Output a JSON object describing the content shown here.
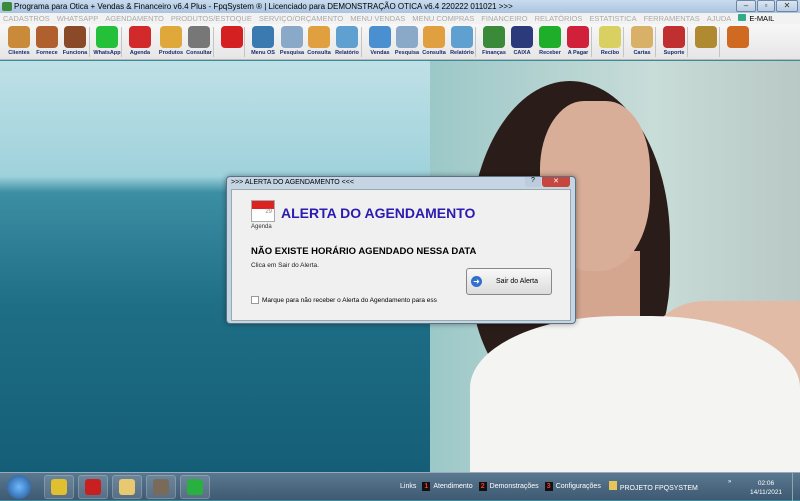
{
  "window": {
    "title": "Programa para Otica + Vendas & Financeiro v6.4 Plus - FpqSystem ® | Licenciado para  DEMONSTRAÇÃO OTICA v6.4 220222 011021 >>>",
    "minimize": "–",
    "maximize": "▫",
    "close": "✕"
  },
  "menu": [
    "CADASTROS",
    "WHATSAPP",
    "AGENDAMENTO",
    "PRODUTOS/ESTOQUE",
    "SERVIÇO/ORÇAMENTO",
    "MENU VENDAS",
    "MENU COMPRAS",
    "FINANCEIRO",
    "RELATÓRIOS",
    "ESTATISTICA",
    "FERRAMENTAS",
    "AJUDA"
  ],
  "menu_email": "E-MAIL",
  "toolbar": [
    {
      "label": "Clientes",
      "color": "#c98a3a"
    },
    {
      "label": "Fornece",
      "color": "#b0602f"
    },
    {
      "label": "Funciona",
      "color": "#8a4a2a"
    },
    {
      "label": "WhatsApp",
      "color": "#25c03a"
    },
    {
      "label": "Agenda",
      "color": "#d22a2a"
    },
    {
      "label": "Produtos",
      "color": "#e0a83a"
    },
    {
      "label": "Consultar",
      "color": "#777777"
    },
    {
      "label": "",
      "color": "#d42020"
    },
    {
      "label": "Menu OS",
      "color": "#3a7ab0"
    },
    {
      "label": "Pesquisa",
      "color": "#8aa8c8"
    },
    {
      "label": "Consulta",
      "color": "#e0a040"
    },
    {
      "label": "Relatório",
      "color": "#60a0d0"
    },
    {
      "label": "Vendas",
      "color": "#4a90d0"
    },
    {
      "label": "Pesquisa",
      "color": "#8aa8c8"
    },
    {
      "label": "Consulta",
      "color": "#e0a040"
    },
    {
      "label": "Relatório",
      "color": "#60a0d0"
    },
    {
      "label": "Finanças",
      "color": "#3a8a3a"
    },
    {
      "label": "CAIXA",
      "color": "#2a3a7a"
    },
    {
      "label": "Receber",
      "color": "#1fae2a"
    },
    {
      "label": "A Pagar",
      "color": "#d0203a"
    },
    {
      "label": "Recibo",
      "color": "#d8d060"
    },
    {
      "label": "Cartas",
      "color": "#d8b068"
    },
    {
      "label": "Suporte",
      "color": "#c03030"
    },
    {
      "label": "",
      "color": "#b08a30"
    },
    {
      "label": "",
      "color": "#d06a20"
    }
  ],
  "dialog": {
    "title": ">>> ALERTA DO AGENDAMENTO <<<",
    "help": "?",
    "close": "✕",
    "icon_label": "Agenda",
    "calendar_day": "29",
    "heading": "ALERTA DO AGENDAMENTO",
    "message": "NÃO EXISTE HORÁRIO AGENDADO NESSA DATA",
    "hint": "Clica em Sair do Alerta.",
    "checkbox_label": "Marque para não receber o Alerta do Agendamento para ess",
    "exit_button": "Sair do Alerta"
  },
  "taskbar": {
    "apps": [
      {
        "name": "chrome",
        "color": "#e0c030"
      },
      {
        "name": "filezilla",
        "color": "#c82020"
      },
      {
        "name": "explorer",
        "color": "#e8c870"
      },
      {
        "name": "user-app",
        "color": "#7a6a5a"
      },
      {
        "name": "fpqsystem",
        "color": "#2ab040"
      }
    ],
    "links_label": "Links",
    "links": [
      {
        "n": "1",
        "label": "Atendimento"
      },
      {
        "n": "2",
        "label": "Demonstrações"
      },
      {
        "n": "3",
        "label": "Configurações"
      }
    ],
    "folder": "PROJETO FPQSYSTEM",
    "time": "02:06",
    "date": "14/11/2021",
    "overflow": "»"
  }
}
